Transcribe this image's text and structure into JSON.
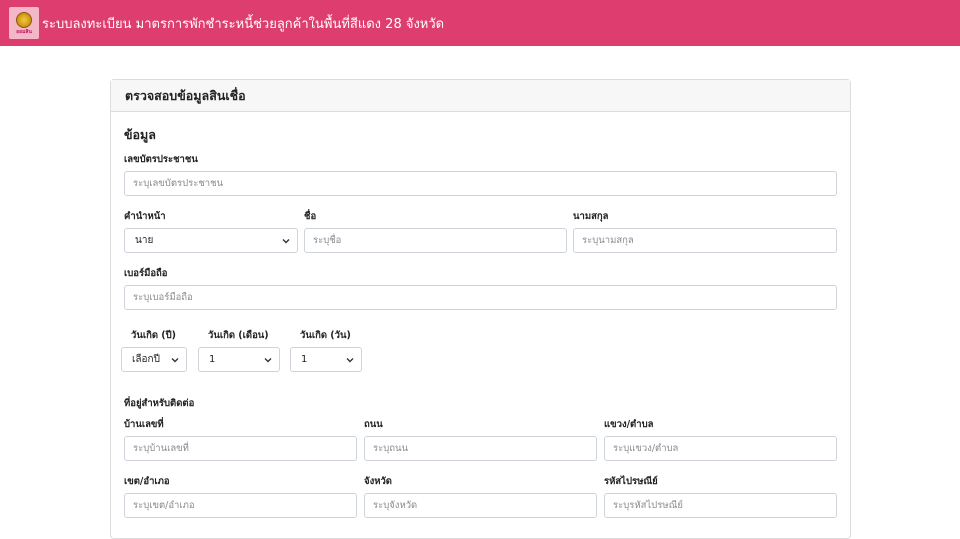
{
  "header": {
    "logo_text": "ออมสิน",
    "title": "ระบบลงทะเบียน มาตรการพักชำระหนี้ช่วยลูกค้าในพื้นที่สีแดง 28 จังหวัด",
    "bg_color": "#dd3e6f"
  },
  "card": {
    "title": "ตรวจสอบข้อมูลสินเชื่อ",
    "section_info": "ข้อมูล",
    "id_card": {
      "label": "เลขบัตรประชาชน",
      "placeholder": "ระบุเลขบัตรประชาชน"
    },
    "prefix": {
      "label": "คำนำหน้า",
      "value": "นาย"
    },
    "first_name": {
      "label": "ชื่อ",
      "placeholder": "ระบุชื่อ"
    },
    "last_name": {
      "label": "นามสกุล",
      "placeholder": "ระบุนามสกุล"
    },
    "mobile": {
      "label": "เบอร์มือถือ",
      "placeholder": "ระบุเบอร์มือถือ"
    },
    "birth_year": {
      "label": "วันเกิด (ปี)",
      "value": "เลือกปี"
    },
    "birth_month": {
      "label": "วันเกิด (เดือน)",
      "value": "1"
    },
    "birth_day": {
      "label": "วันเกิด (วัน)",
      "value": "1"
    },
    "section_address": "ที่อยู่สำหรับติดต่อ",
    "house_no": {
      "label": "บ้านเลขที่",
      "placeholder": "ระบุบ้านเลขที่"
    },
    "road": {
      "label": "ถนน",
      "placeholder": "ระบุถนน"
    },
    "subdistrict": {
      "label": "แขวง/ตำบล",
      "placeholder": "ระบุแขวง/ตำบล"
    },
    "district": {
      "label": "เขต/อำเภอ",
      "placeholder": "ระบุเขต/อำเภอ"
    },
    "province": {
      "label": "จังหวัด",
      "placeholder": "ระบุจังหวัด"
    },
    "postcode": {
      "label": "รหัสไปรษณีย์",
      "placeholder": "ระบุรหัสไปรษณีย์"
    }
  }
}
